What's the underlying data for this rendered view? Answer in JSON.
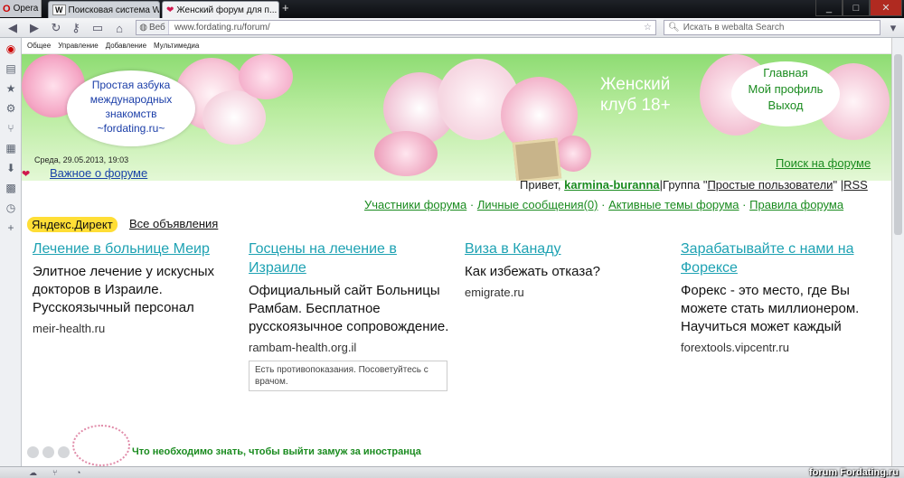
{
  "browser": {
    "menu_label": "Opera",
    "tabs": [
      {
        "label": "Поисковая система W...",
        "icon": "w-logo-icon"
      },
      {
        "label": "Женский форум для п...",
        "icon": "heart-icon"
      }
    ],
    "new_tab": "+",
    "window_controls": {
      "minimize": "_",
      "maximize": "□",
      "close": "✕"
    }
  },
  "address": {
    "web_label": "Веб",
    "url": "www.fordating.ru/forum/",
    "search_placeholder": "Искать в webalta Search"
  },
  "bookmarks": [
    "Общее",
    "Управление",
    "Добавление",
    "Мультимедиа"
  ],
  "banner": {
    "bubble_left": [
      "Простая азбука",
      "международных",
      "знакомств",
      "~fordating.ru~"
    ],
    "club_line1": "Женский",
    "club_line2": "клуб 18+",
    "links": [
      "Главная",
      "Мой профиль",
      "Выход"
    ],
    "date": "Среда, 29.05.2013, 19:03",
    "important": "Важное о форуме",
    "forum_search": "Поиск на форуме"
  },
  "user": {
    "greeting": "Привет,",
    "username": "karmina-buranna",
    "group_prefix": "|Группа \"",
    "group": "Простые пользователи",
    "group_suffix": "\"",
    "rss": "RSS"
  },
  "forum_nav": [
    "Участники форума",
    "Личные сообщения(0)",
    "Активные темы форума",
    "Правила форума"
  ],
  "ads_header": {
    "ydirect": "Яндекс.Директ",
    "all": "Все объявления"
  },
  "ads": [
    {
      "title": "Лечение в больнице Меир",
      "text": "Элитное лечение у искусных докторов в Израиле. Русскоязычный персонал",
      "domain": "meir-health.ru"
    },
    {
      "title": "Госцены на лечение в Израиле",
      "text": "Официальный сайт Больницы Рамбам. Бесплатное русскоязычное сопровождение.",
      "domain": "rambam-health.org.il",
      "warning": "Есть противопоказания. Посоветуйтесь с врачом."
    },
    {
      "title": "Виза в Канаду",
      "text": "Как избежать отказа?",
      "domain": "emigrate.ru"
    },
    {
      "title": "Зарабатывайте с нами на Форексе",
      "text": "Форекс - это место, где Вы можете стать миллионером. Научиться может каждый",
      "domain": "forextools.vipcentr.ru"
    }
  ],
  "bottom_link": "Что необходимо знать, чтобы выйти замуж за иностранца",
  "status_text": "forum Fordating.ru",
  "colors": {
    "banner_green": "#8edc73",
    "link_green": "#1a8b1f",
    "ad_link": "#1ea2b3",
    "yandex_yellow": "#ffde36"
  }
}
